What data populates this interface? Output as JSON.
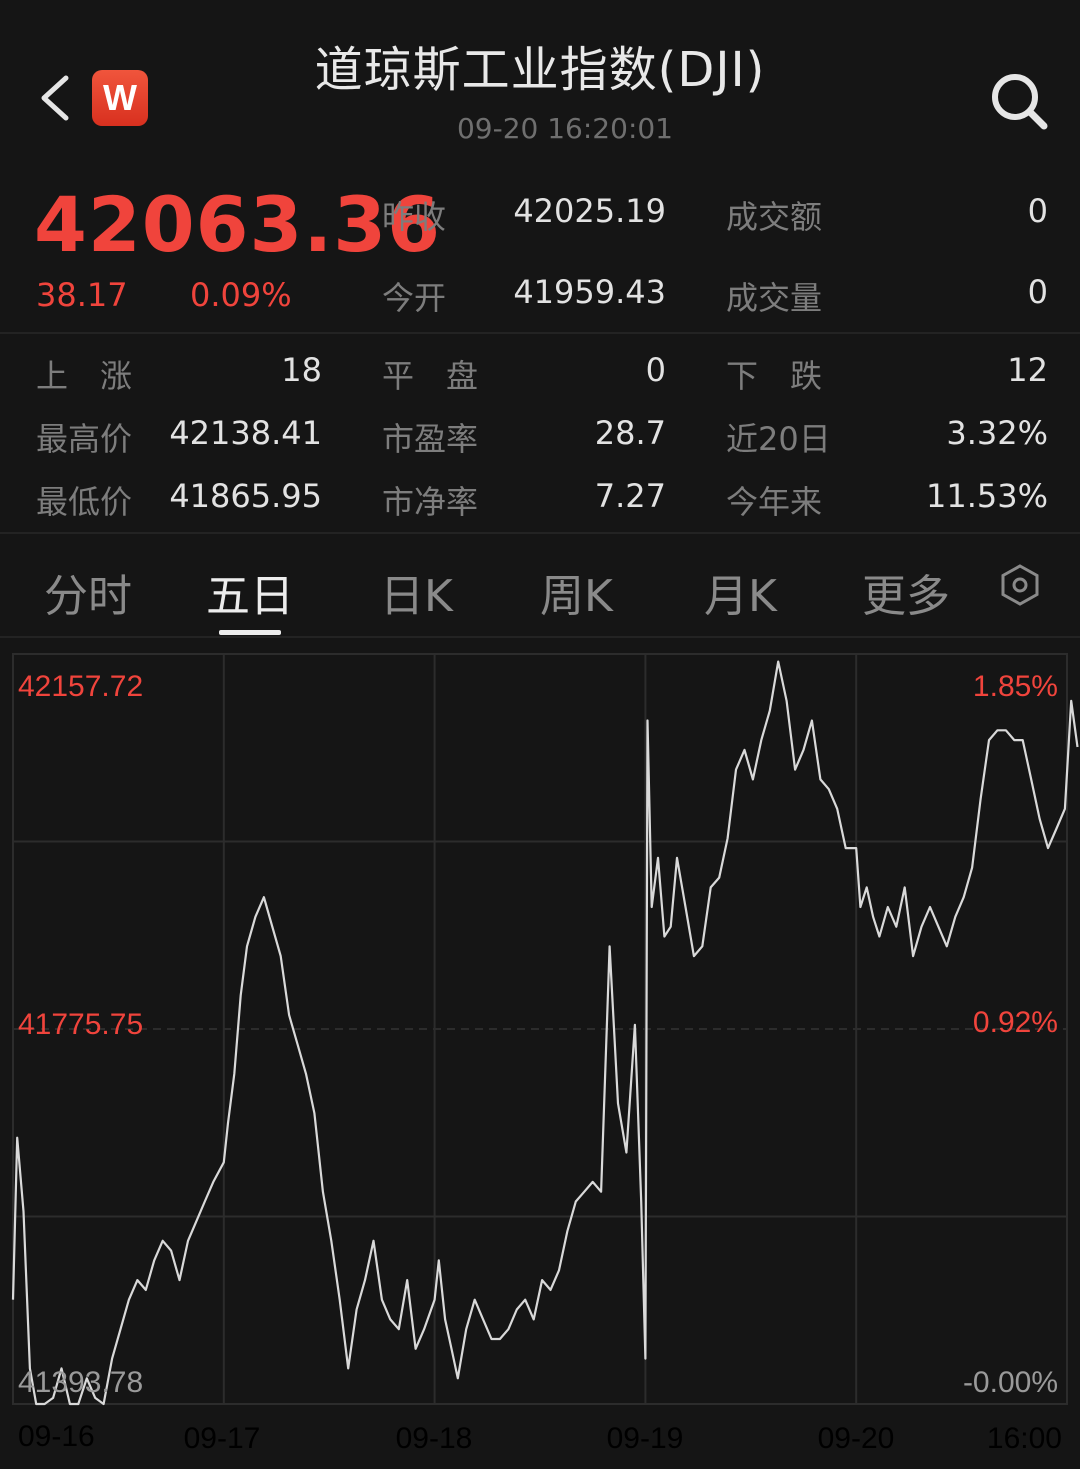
{
  "header": {
    "title": "道琼斯工业指数(DJI)",
    "datetime": "09-20 16:20:01",
    "app_badge": "W"
  },
  "quote": {
    "price": "42063.36",
    "change": "38.17",
    "change_pct": "0.09%",
    "prev_close_label": "昨收",
    "prev_close": "42025.19",
    "open_label": "今开",
    "open": "41959.43",
    "turnover_label": "成交额",
    "turnover": "0",
    "volume_label": "成交量",
    "volume": "0"
  },
  "stats": {
    "rise_label": "上　涨",
    "rise": "18",
    "flat_label": "平　盘",
    "flat": "0",
    "fall_label": "下　跌",
    "fall": "12",
    "high_label": "最高价",
    "high": "42138.41",
    "pe_label": "市盈率",
    "pe": "28.7",
    "d20_label": "近20日",
    "d20": "3.32%",
    "low_label": "最低价",
    "low": "41865.95",
    "pb_label": "市净率",
    "pb": "7.27",
    "ytd_label": "今年来",
    "ytd": "11.53%"
  },
  "tabs": [
    {
      "label": "分时"
    },
    {
      "label": "五日"
    },
    {
      "label": "日K"
    },
    {
      "label": "周K"
    },
    {
      "label": "月K"
    },
    {
      "label": "更多"
    }
  ],
  "colors": {
    "up": "#f0443c",
    "line": "#d9d9d9",
    "grid": "#2c2c2c",
    "background": "#151515"
  },
  "chart_data": {
    "type": "line",
    "y_left_labels": [
      "42157.72",
      "41775.75",
      "41393.78"
    ],
    "y_right_labels": [
      "1.85%",
      "0.92%",
      "-0.00%"
    ],
    "ylim": [
      41393.78,
      42157.72
    ],
    "x_labels": [
      "09-16",
      "09-17",
      "09-18",
      "09-19",
      "09-20",
      "16:00"
    ],
    "series": [
      {
        "x": [
          0,
          0.02,
          0.05,
          0.08,
          0.11,
          0.15,
          0.19,
          0.23,
          0.27,
          0.31,
          0.35,
          0.39,
          0.43,
          0.47,
          0.51,
          0.55,
          0.59,
          0.63,
          0.67,
          0.71,
          0.75,
          0.79,
          0.83,
          0.87,
          0.91,
          0.95,
          1.0,
          1.02,
          1.05,
          1.08,
          1.11,
          1.15,
          1.19,
          1.23,
          1.27,
          1.31,
          1.35,
          1.39,
          1.43,
          1.47,
          1.51,
          1.55,
          1.59,
          1.63,
          1.67,
          1.71,
          1.75,
          1.79,
          1.83,
          1.87,
          1.91,
          1.95,
          2.0,
          2.02,
          2.05,
          2.08,
          2.11,
          2.15,
          2.19,
          2.23,
          2.27,
          2.31,
          2.35,
          2.39,
          2.43,
          2.47,
          2.51,
          2.55,
          2.59,
          2.63,
          2.67,
          2.71,
          2.75,
          2.79,
          2.83,
          2.87,
          2.91,
          2.95,
          2.98,
          3.0,
          3.01,
          3.03,
          3.06,
          3.09,
          3.12,
          3.15,
          3.19,
          3.23,
          3.27,
          3.31,
          3.35,
          3.39,
          3.43,
          3.47,
          3.51,
          3.55,
          3.59,
          3.63,
          3.67,
          3.71,
          3.75,
          3.79,
          3.83,
          3.87,
          3.91,
          3.95,
          4.0,
          4.02,
          4.05,
          4.08,
          4.11,
          4.15,
          4.19,
          4.23,
          4.27,
          4.31,
          4.35,
          4.39,
          4.43,
          4.47,
          4.51,
          4.55,
          4.59,
          4.63,
          4.67,
          4.71,
          4.75,
          4.79,
          4.83,
          4.87,
          4.91,
          4.95,
          4.99,
          5.02,
          5.05
        ],
        "values": [
          41500,
          41665,
          41590,
          41430,
          41380,
          41350,
          41400,
          41430,
          41390,
          41370,
          41420,
          41400,
          41390,
          41440,
          41470,
          41500,
          41520,
          41510,
          41540,
          41560,
          41550,
          41520,
          41560,
          41580,
          41600,
          41620,
          41640,
          41680,
          41730,
          41810,
          41860,
          41890,
          41910,
          41880,
          41850,
          41790,
          41760,
          41730,
          41690,
          41610,
          41560,
          41500,
          41430,
          41490,
          41520,
          41560,
          41500,
          41480,
          41470,
          41520,
          41450,
          41470,
          41500,
          41540,
          41480,
          41450,
          41420,
          41470,
          41500,
          41480,
          41460,
          41460,
          41470,
          41490,
          41500,
          41480,
          41520,
          41510,
          41530,
          41570,
          41600,
          41610,
          41620,
          41610,
          41860,
          41700,
          41650,
          41780,
          41600,
          41440,
          42090,
          41900,
          41950,
          41870,
          41880,
          41950,
          41900,
          41850,
          41860,
          41920,
          41930,
          41970,
          42040,
          42060,
          42030,
          42070,
          42100,
          42150,
          42110,
          42040,
          42060,
          42090,
          42030,
          42020,
          42000,
          41960,
          41960,
          41900,
          41920,
          41890,
          41870,
          41900,
          41880,
          41920,
          41850,
          41880,
          41900,
          41880,
          41860,
          41890,
          41910,
          41940,
          42010,
          42070,
          42080,
          42080,
          42070,
          42070,
          42030,
          41990,
          41960,
          41980,
          42000,
          42110,
          42063
        ]
      }
    ]
  }
}
